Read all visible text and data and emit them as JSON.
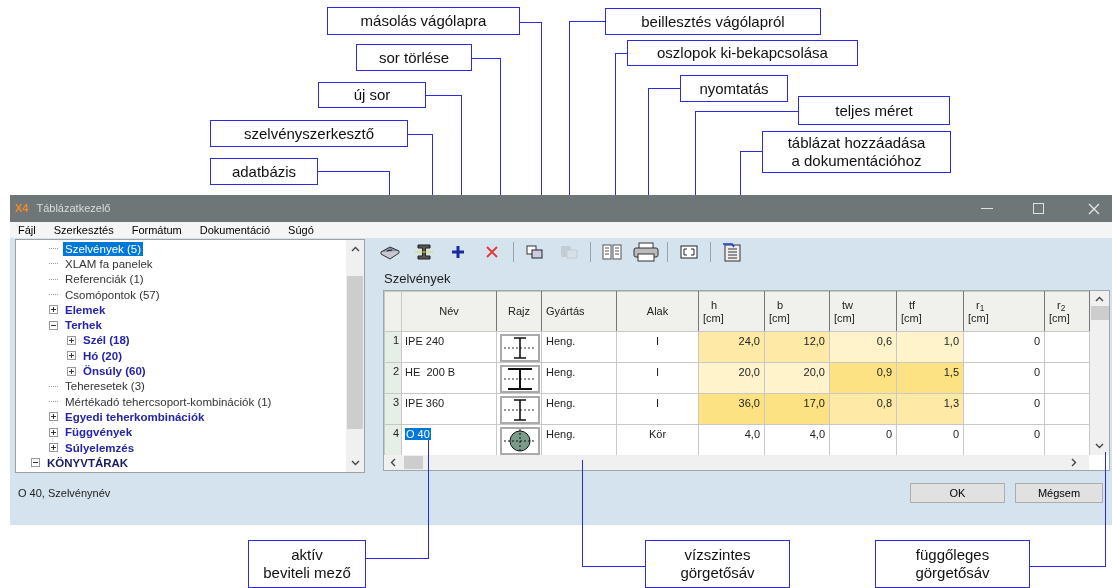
{
  "window": {
    "logo": "X4",
    "title": "Táblázatkezelő"
  },
  "menu": [
    "Fájl",
    "Szerkesztés",
    "Formátum",
    "Dokumentáció",
    "Súgó"
  ],
  "tree": {
    "items": [
      {
        "label": "Szelvények (5)",
        "selected": true
      },
      {
        "label": "XLAM fa panelek",
        "selected": false
      },
      {
        "label": "Referenciák (1)",
        "selected": false
      },
      {
        "label": "Csomópontok (57)",
        "selected": false
      },
      {
        "label": "Elemek",
        "selected": false,
        "expanded": false
      },
      {
        "label": "Terhek",
        "selected": false,
        "expanded": true,
        "children": [
          {
            "label": "Szél (18)",
            "selected": false,
            "expanded": false
          },
          {
            "label": "Hó (20)",
            "selected": false,
            "expanded": false
          },
          {
            "label": "Önsúly (60)",
            "selected": false,
            "expanded": false
          }
        ]
      },
      {
        "label": "Teheresetek (3)",
        "selected": false
      },
      {
        "label": "Mértékadó tehercsoport-kombinációk (1)",
        "selected": false
      },
      {
        "label": "Egyedi teherkombinációk",
        "selected": false,
        "expanded": false
      },
      {
        "label": "Függvények",
        "selected": false,
        "expanded": false
      },
      {
        "label": "Súlyelemzés",
        "selected": false,
        "expanded": false
      }
    ],
    "root": {
      "label": "KÖNYVTÁRAK",
      "selected": false,
      "expanded": true
    }
  },
  "toolbar": [
    {
      "kind": "database",
      "disabled": false
    },
    {
      "kind": "section-editor",
      "disabled": false
    },
    {
      "kind": "add",
      "disabled": false
    },
    {
      "kind": "delete",
      "disabled": false
    },
    {
      "kind": "separator"
    },
    {
      "kind": "copy",
      "disabled": false
    },
    {
      "kind": "paste",
      "disabled": true
    },
    {
      "kind": "separator"
    },
    {
      "kind": "columns",
      "disabled": false
    },
    {
      "kind": "print",
      "disabled": false
    },
    {
      "kind": "separator"
    },
    {
      "kind": "fullsize",
      "disabled": false
    },
    {
      "kind": "separator"
    },
    {
      "kind": "add-to-doc",
      "disabled": false
    }
  ],
  "table": {
    "title": "Szelvények",
    "columns": [
      {
        "name": "Név"
      },
      {
        "name": "Rajz"
      },
      {
        "name": "Gyártás"
      },
      {
        "name": "Alak"
      },
      {
        "name": "h",
        "unit": "[cm]"
      },
      {
        "name": "b",
        "unit": "[cm]"
      },
      {
        "name": "tw",
        "unit": "[cm]"
      },
      {
        "name": "tf",
        "unit": "[cm]"
      },
      {
        "name": "r$_{1}$",
        "unit": "[cm]"
      },
      {
        "name": "r$_{2}$",
        "unit": "[cm]"
      }
    ],
    "rows": [
      {
        "number": "1",
        "name": "IPE 240",
        "selected": false,
        "kind": "i-narrow",
        "manufacture": "Heng.",
        "shape": "I",
        "values": [
          {
            "text": "24,0",
            "color": "#fee9a6"
          },
          {
            "text": "12,0",
            "color": "#fee9a6"
          },
          {
            "text": "0,6",
            "color": "#fff3cc"
          },
          {
            "text": "1,0",
            "color": "#fff3cc"
          },
          {
            "text": "0"
          }
        ]
      },
      {
        "number": "2",
        "name": "HE  200 B",
        "selected": false,
        "kind": "i-wide",
        "manufacture": "Heng.",
        "shape": "I",
        "values": [
          {
            "text": "20,0",
            "color": "#fff3cc"
          },
          {
            "text": "20,0",
            "color": "#fff3cc"
          },
          {
            "text": "0,9",
            "color": "#fde283"
          },
          {
            "text": "1,5",
            "color": "#fde283"
          },
          {
            "text": "0"
          }
        ]
      },
      {
        "number": "3",
        "name": "IPE 360",
        "selected": false,
        "kind": "i-narrow",
        "manufacture": "Heng.",
        "shape": "I",
        "values": [
          {
            "text": "36,0",
            "color": "#fde283"
          },
          {
            "text": "17,0",
            "color": "#fde283"
          },
          {
            "text": "0,8",
            "color": "#fee9a6"
          },
          {
            "text": "1,3",
            "color": "#fee9a6"
          },
          {
            "text": "0"
          }
        ]
      },
      {
        "number": "4",
        "name": "O 40",
        "selected": true,
        "kind": "circle",
        "manufacture": "Heng.",
        "shape": "Kör",
        "values": [
          {
            "text": "4,0"
          },
          {
            "text": "4,0"
          },
          {
            "text": "0"
          },
          {
            "text": "0"
          },
          {
            "text": "0"
          }
        ]
      }
    ]
  },
  "status": "O 40, Szelvénynév",
  "buttons": [
    "OK",
    "Mégsem"
  ],
  "callouts": [
    {
      "text": "másolás vágólapra"
    },
    {
      "text": "sor törlése"
    },
    {
      "text": "új sor"
    },
    {
      "text": "szelvényszerkesztő"
    },
    {
      "text": "adatbázis"
    },
    {
      "text": "beillesztés vágólapról"
    },
    {
      "text": "oszlopok ki-bekapcsolása"
    },
    {
      "text": "nyomtatás"
    },
    {
      "text": "teljes méret"
    },
    {
      "text": "táblázat hozzáadása\na dokumentációhoz"
    },
    {
      "text": "aktív\nbeviteli mező"
    },
    {
      "text": "vízszintes\ngörgetősáv"
    },
    {
      "text": "függőleges\ngörgetősáv"
    }
  ]
}
